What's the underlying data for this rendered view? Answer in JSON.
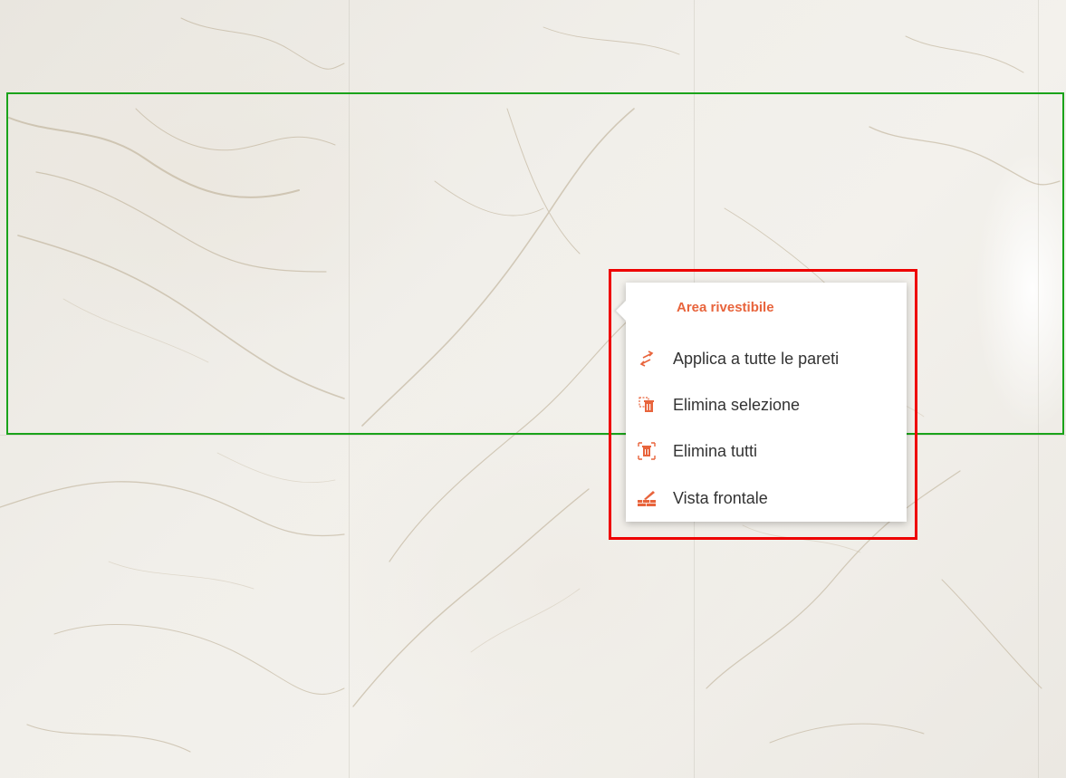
{
  "menu": {
    "title": "Area rivestibile",
    "items": [
      {
        "label": "Applica a tutte le pareti",
        "icon": "swap-arrows-icon"
      },
      {
        "label": "Elimina selezione",
        "icon": "delete-selection-icon"
      },
      {
        "label": "Elimina tutti",
        "icon": "delete-all-icon"
      },
      {
        "label": "Vista frontale",
        "icon": "front-view-icon"
      }
    ]
  },
  "colors": {
    "accent": "#e8643c",
    "selection_border": "#1aa31a",
    "highlight_border": "#ee0000",
    "menu_text": "#333333"
  }
}
